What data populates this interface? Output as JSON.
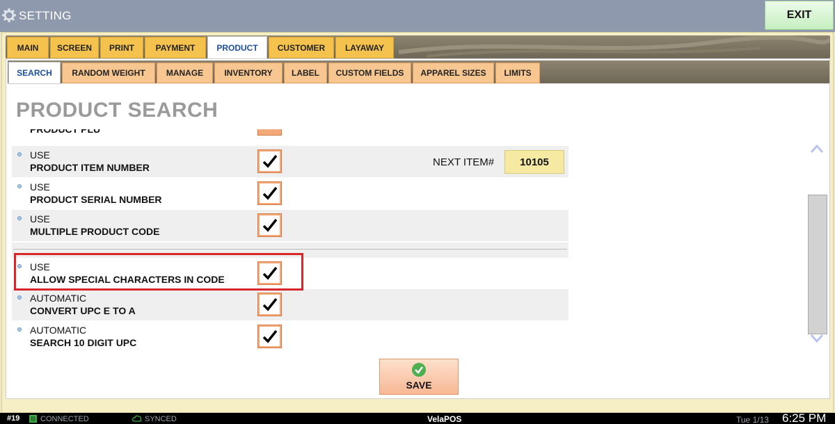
{
  "window": {
    "title": "SETTING",
    "exit_label": "EXIT"
  },
  "tabs_primary": [
    {
      "label": "MAIN"
    },
    {
      "label": "SCREEN"
    },
    {
      "label": "PRINT"
    },
    {
      "label": "PAYMENT"
    },
    {
      "label": "PRODUCT",
      "active": true
    },
    {
      "label": "CUSTOMER"
    },
    {
      "label": "LAYAWAY"
    }
  ],
  "tabs_secondary": [
    {
      "label": "SEARCH",
      "active": true
    },
    {
      "label": "RANDOM WEIGHT"
    },
    {
      "label": "MANAGE"
    },
    {
      "label": "INVENTORY"
    },
    {
      "label": "LABEL"
    },
    {
      "label": "CUSTOM FIELDS"
    },
    {
      "label": "APPAREL SIZES"
    },
    {
      "label": "LIMITS"
    }
  ],
  "page": {
    "heading": "PRODUCT SEARCH",
    "partial_row_label": "PRODUCT PLU"
  },
  "options": [
    {
      "line1": "USE",
      "line2": "PRODUCT ITEM NUMBER",
      "checked": true
    },
    {
      "line1": "USE",
      "line2": "PRODUCT SERIAL NUMBER",
      "checked": true
    },
    {
      "line1": "USE",
      "line2": "MULTIPLE PRODUCT CODE",
      "checked": true
    },
    {
      "line1": "USE",
      "line2": "ALLOW SPECIAL CHARACTERS IN CODE",
      "checked": true
    },
    {
      "line1": "AUTOMATIC",
      "line2": "CONVERT UPC E TO A",
      "checked": true
    },
    {
      "line1": "AUTOMATIC",
      "line2": "SEARCH 10 DIGIT UPC",
      "checked": true
    }
  ],
  "next_item": {
    "label": "NEXT ITEM#",
    "value": "10105"
  },
  "save_label": "SAVE",
  "status": {
    "terminal": "#19",
    "connection": "CONNECTED",
    "sync": "SYNCED",
    "brand": "VelaPOS",
    "date": "Tue 1/13",
    "time": "6:25 PM"
  },
  "colors": {
    "accent_tab": "#f5c24e",
    "sub_tab": "#f8c690",
    "highlight": "#d6262a",
    "save_icon": "#4caf50"
  }
}
